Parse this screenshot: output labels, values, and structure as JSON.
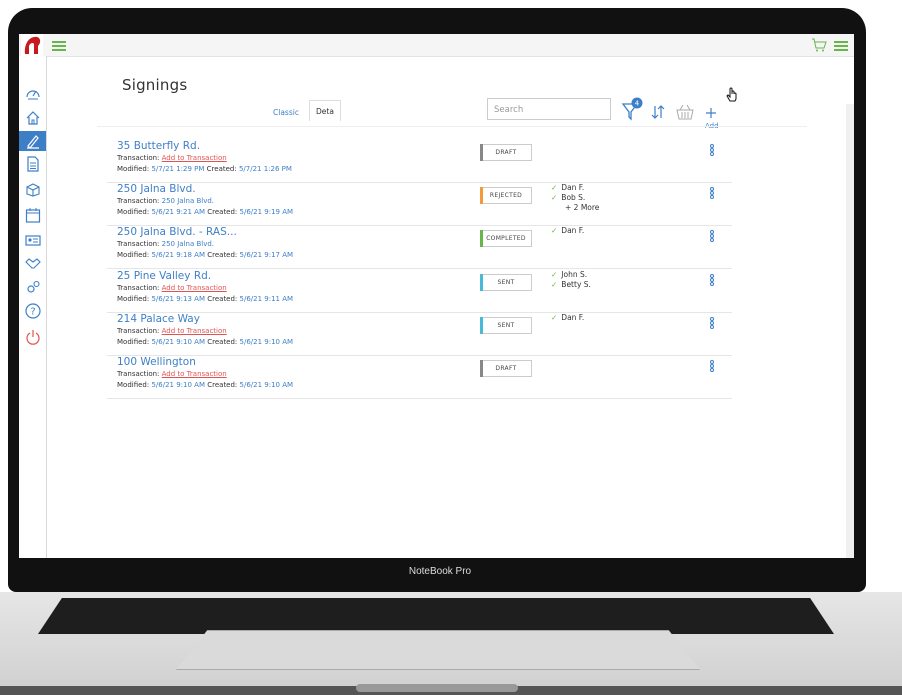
{
  "device": {
    "brand_label": "NoteBook Pro"
  },
  "page": {
    "title": "Signings",
    "view_toggle": {
      "classic_label": "Classic",
      "detail_label": "Deta"
    },
    "search": {
      "placeholder": "Search"
    },
    "filter_badge": "4",
    "add_label": "Add"
  },
  "colors": {
    "accent": "#3d7fc7",
    "link_red": "#e05353",
    "green": "#67b64a",
    "draft": "#888888",
    "rejected": "#f39a3b",
    "completed": "#67b64a",
    "sent": "#4ab8d8"
  },
  "rows": [
    {
      "address": "35 Butterfly Rd.",
      "transaction_label": "Transaction:",
      "transaction": "Add to Transaction",
      "transaction_is_link": true,
      "modified_label": "Modified:",
      "modified": "5/7/21 1:29 PM",
      "created_label": "Created:",
      "created": "5/7/21 1:26 PM",
      "status": "DRAFT",
      "status_color": "#888888",
      "signers": [],
      "more": ""
    },
    {
      "address": "250 Jalna Blvd.",
      "transaction_label": "Transaction:",
      "transaction": "250 Jalna Blvd.",
      "transaction_is_link": false,
      "modified_label": "Modified:",
      "modified": "5/6/21 9:21 AM",
      "created_label": "Created:",
      "created": "5/6/21 9:19 AM",
      "status": "REJECTED",
      "status_color": "#f39a3b",
      "signers": [
        "Dan F.",
        "Bob S."
      ],
      "more": "+ 2 More"
    },
    {
      "address": "250 Jalna Blvd. - RAS...",
      "transaction_label": "Transaction:",
      "transaction": "250 Jalna Blvd.",
      "transaction_is_link": false,
      "modified_label": "Modified:",
      "modified": "5/6/21 9:18 AM",
      "created_label": "Created:",
      "created": "5/6/21 9:17 AM",
      "status": "COMPLETED",
      "status_color": "#67b64a",
      "signers": [
        "Dan F."
      ],
      "more": ""
    },
    {
      "address": "25 Pine Valley Rd.",
      "transaction_label": "Transaction:",
      "transaction": "Add to Transaction",
      "transaction_is_link": true,
      "modified_label": "Modified:",
      "modified": "5/6/21 9:13 AM",
      "created_label": "Created:",
      "created": "5/6/21 9:11 AM",
      "status": "SENT",
      "status_color": "#4ab8d8",
      "signers": [
        "John S.",
        "Betty S."
      ],
      "more": ""
    },
    {
      "address": "214 Palace Way",
      "transaction_label": "Transaction:",
      "transaction": "Add to Transaction",
      "transaction_is_link": true,
      "modified_label": "Modified:",
      "modified": "5/6/21 9:10 AM",
      "created_label": "Created:",
      "created": "5/6/21 9:10 AM",
      "status": "SENT",
      "status_color": "#4ab8d8",
      "signers": [
        "Dan F."
      ],
      "more": ""
    },
    {
      "address": "100 Wellington",
      "transaction_label": "Transaction:",
      "transaction": "Add to Transaction",
      "transaction_is_link": true,
      "modified_label": "Modified:",
      "modified": "5/6/21 9:10 AM",
      "created_label": "Created:",
      "created": "5/6/21 9:10 AM",
      "status": "DRAFT",
      "status_color": "#888888",
      "signers": [],
      "more": ""
    }
  ],
  "sidebar": {
    "icons": [
      "dashboard-icon",
      "home-icon",
      "signing-pen-icon",
      "document-icon",
      "package-icon",
      "calendar-icon",
      "contact-card-icon",
      "handshake-icon",
      "settings-cogs-icon",
      "help-icon",
      "power-icon"
    ]
  }
}
